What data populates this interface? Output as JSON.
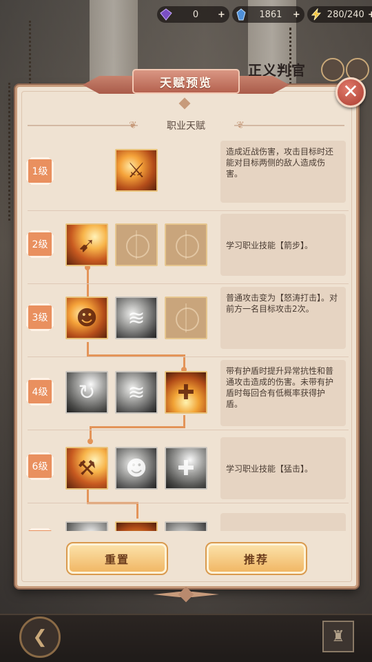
{
  "scene": {
    "title": "正义判官"
  },
  "currencies": [
    {
      "icon": "purple-gem-icon",
      "value": "0",
      "plus": "+"
    },
    {
      "icon": "blue-crystal-icon",
      "value": "1861",
      "plus": "+"
    },
    {
      "icon": "lightning-energy-icon",
      "value": "280/240",
      "plus": "+"
    }
  ],
  "dialog": {
    "title": "天赋预览",
    "close_label": "✕",
    "section_label": "职业天赋",
    "rows": [
      {
        "level": "1级",
        "description": "造成近战伤害，攻击目标时还能对目标两侧的敌人造成伤害。"
      },
      {
        "level": "2级",
        "description": "学习职业技能【箭步】。"
      },
      {
        "level": "3级",
        "description": "普通攻击变为【怒涛打击】。对前方一名目标攻击2次。"
      },
      {
        "level": "4级",
        "description": "带有护盾时提升异常抗性和普通攻击造成的伤害。未带有护盾时每回合有低概率获得护盾。"
      },
      {
        "level": "6级",
        "description": "学习职业技能【猛击】。"
      },
      {
        "level": "",
        "description": ""
      }
    ],
    "buttons": {
      "reset": "重置",
      "recommend": "推荐"
    }
  },
  "colors": {
    "accent_orange": "#e9905f",
    "close_red": "#a93a2e",
    "panel_bg": "#efe2d2",
    "button_gold": "#f1b765"
  }
}
